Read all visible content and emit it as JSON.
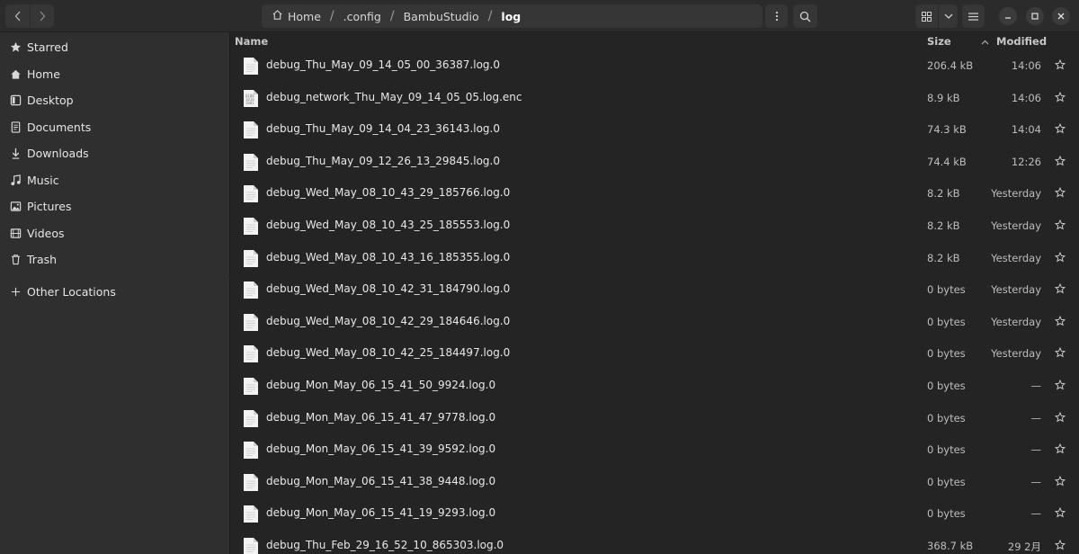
{
  "header": {
    "path": [
      {
        "label": "Home"
      },
      {
        "label": ".config"
      },
      {
        "label": "BambuStudio"
      },
      {
        "label": "log"
      }
    ],
    "separator": "/"
  },
  "sidebar": {
    "items": [
      {
        "label": "Starred",
        "icon": "star-icon"
      },
      {
        "label": "Home",
        "icon": "home-icon"
      },
      {
        "label": "Desktop",
        "icon": "desktop-icon"
      },
      {
        "label": "Documents",
        "icon": "documents-icon"
      },
      {
        "label": "Downloads",
        "icon": "downloads-icon"
      },
      {
        "label": "Music",
        "icon": "music-icon"
      },
      {
        "label": "Pictures",
        "icon": "pictures-icon"
      },
      {
        "label": "Videos",
        "icon": "videos-icon"
      },
      {
        "label": "Trash",
        "icon": "trash-icon"
      }
    ],
    "other_locations": {
      "label": "Other Locations",
      "icon": "plus-icon"
    }
  },
  "list": {
    "columns": {
      "name": "Name",
      "size": "Size",
      "modified": "Modified"
    },
    "files": [
      {
        "name": "debug_Thu_May_09_14_05_00_36387.log.0",
        "size": "206.4 kB",
        "modified": "14:06",
        "icon": "text-file-icon"
      },
      {
        "name": "debug_network_Thu_May_09_14_05_05.log.enc",
        "size": "8.9 kB",
        "modified": "14:06",
        "icon": "binary-file-icon"
      },
      {
        "name": "debug_Thu_May_09_14_04_23_36143.log.0",
        "size": "74.3 kB",
        "modified": "14:04",
        "icon": "text-file-icon"
      },
      {
        "name": "debug_Thu_May_09_12_26_13_29845.log.0",
        "size": "74.4 kB",
        "modified": "12:26",
        "icon": "text-file-icon"
      },
      {
        "name": "debug_Wed_May_08_10_43_29_185766.log.0",
        "size": "8.2 kB",
        "modified": "Yesterday",
        "icon": "text-file-icon"
      },
      {
        "name": "debug_Wed_May_08_10_43_25_185553.log.0",
        "size": "8.2 kB",
        "modified": "Yesterday",
        "icon": "text-file-icon"
      },
      {
        "name": "debug_Wed_May_08_10_43_16_185355.log.0",
        "size": "8.2 kB",
        "modified": "Yesterday",
        "icon": "text-file-icon"
      },
      {
        "name": "debug_Wed_May_08_10_42_31_184790.log.0",
        "size": "0 bytes",
        "modified": "Yesterday",
        "icon": "text-file-icon"
      },
      {
        "name": "debug_Wed_May_08_10_42_29_184646.log.0",
        "size": "0 bytes",
        "modified": "Yesterday",
        "icon": "text-file-icon"
      },
      {
        "name": "debug_Wed_May_08_10_42_25_184497.log.0",
        "size": "0 bytes",
        "modified": "Yesterday",
        "icon": "text-file-icon"
      },
      {
        "name": "debug_Mon_May_06_15_41_50_9924.log.0",
        "size": "0 bytes",
        "modified": "—",
        "icon": "text-file-icon"
      },
      {
        "name": "debug_Mon_May_06_15_41_47_9778.log.0",
        "size": "0 bytes",
        "modified": "—",
        "icon": "text-file-icon"
      },
      {
        "name": "debug_Mon_May_06_15_41_39_9592.log.0",
        "size": "0 bytes",
        "modified": "—",
        "icon": "text-file-icon"
      },
      {
        "name": "debug_Mon_May_06_15_41_38_9448.log.0",
        "size": "0 bytes",
        "modified": "—",
        "icon": "text-file-icon"
      },
      {
        "name": "debug_Mon_May_06_15_41_19_9293.log.0",
        "size": "0 bytes",
        "modified": "—",
        "icon": "text-file-icon"
      },
      {
        "name": "debug_Thu_Feb_29_16_52_10_865303.log.0",
        "size": "368.7 kB",
        "modified": "29 2月",
        "icon": "text-file-icon"
      }
    ]
  },
  "colors": {
    "background": "#242424",
    "sidebar": "#2f2f2f",
    "headerbar": "#2b2b2b",
    "button": "#363636"
  }
}
